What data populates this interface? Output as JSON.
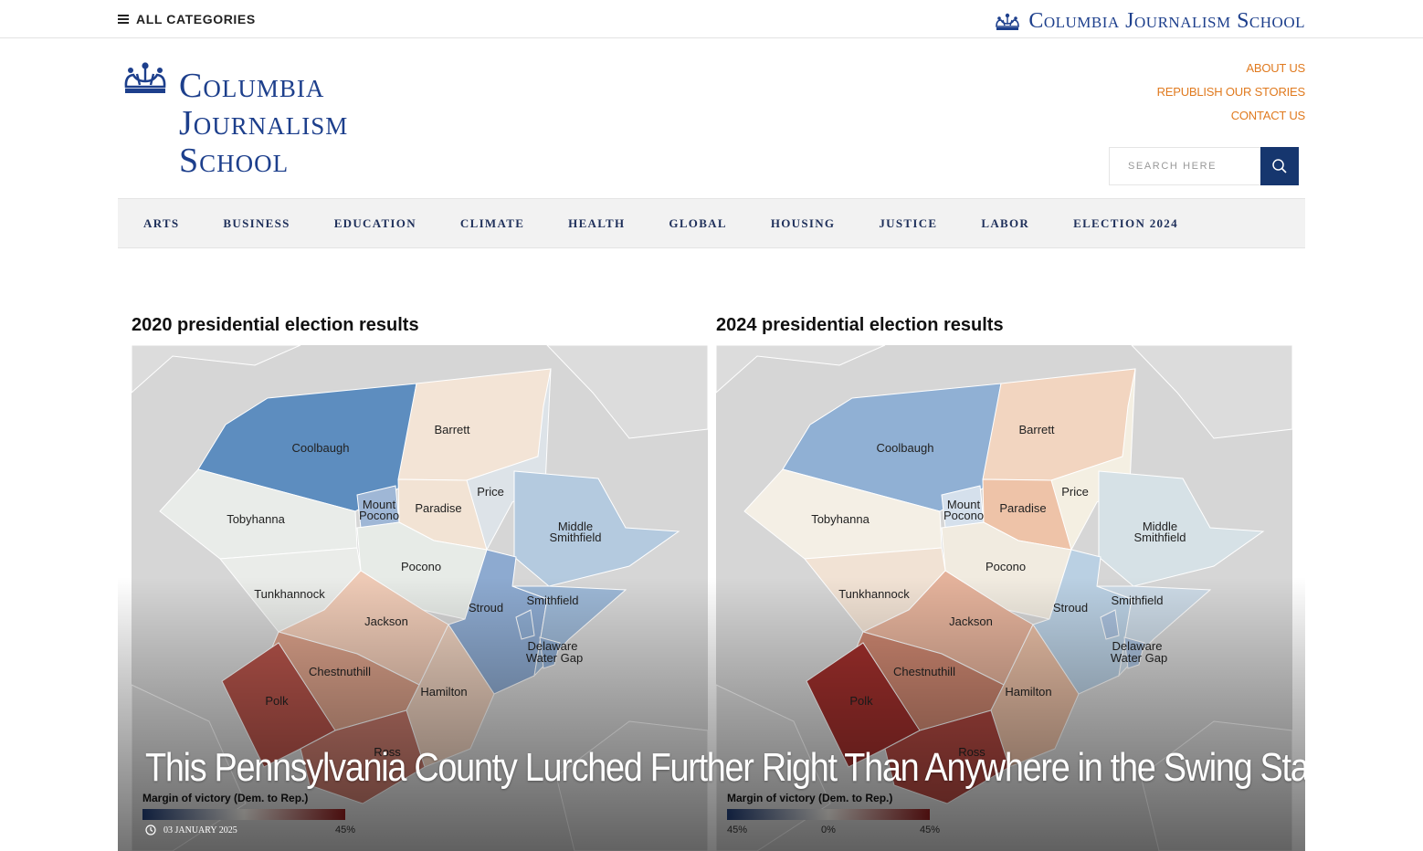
{
  "topbar": {
    "all_categories": "ALL CATEGORIES",
    "logo_text": "Columbia Journalism School"
  },
  "header": {
    "logo_lines": [
      "Columbia",
      "Journalism",
      "School"
    ],
    "links": [
      "ABOUT US",
      "REPUBLISH OUR STORIES",
      "CONTACT US"
    ],
    "search_placeholder": "SEARCH HERE"
  },
  "nav": [
    "ARTS",
    "BUSINESS",
    "EDUCATION",
    "CLIMATE",
    "HEALTH",
    "GLOBAL",
    "HOUSING",
    "JUSTICE",
    "LABOR",
    "ELECTION 2024"
  ],
  "hero": {
    "map_left_title": "2020 presidential election results",
    "map_right_title": "2024 presidential election results",
    "headline": "This Pennsylvania County Lurched Further Right Than Anywhere in the Swing State",
    "date": "03 JANUARY 2025",
    "legend_title": "Margin of victory (Dem. to Rep.)",
    "legend_ticks": [
      "45%",
      "0%",
      "45%"
    ],
    "map_labels": {
      "coolbaugh": "Coolbaugh",
      "barrett": "Barrett",
      "tobyhanna": "Tobyhanna",
      "mount": "Mount",
      "pocono_small": "Pocono",
      "paradise": "Paradise",
      "price": "Price",
      "middle": "Middle",
      "smithfield_line": "Smithfield",
      "pocono": "Pocono",
      "tunkhannock": "Tunkhannock",
      "stroud": "Stroud",
      "smithfield": "Smithfield",
      "jackson": "Jackson",
      "delaware": "Delaware",
      "watergap": "Water Gap",
      "chestnuthill": "Chestnuthill",
      "hamilton": "Hamilton",
      "polk": "Polk",
      "ross": "Ross"
    },
    "colors": {
      "left": {
        "coolbaugh": "#5d8dbf",
        "barrett": "#f3e4d6",
        "tobyhanna": "#e9ece9",
        "price": "#dde3e8",
        "mtpocono": "#9fb7d6",
        "paradise": "#f2e3d4",
        "middle": "#b4cadf",
        "pocono": "#e7ebe7",
        "tunkhannock": "#eaece9",
        "stroud": "#8daad0",
        "smithfield": "#9db8d6",
        "jackson": "#eecab6",
        "chestnuthill": "#d9a089",
        "hamilton": "#ebcfbd",
        "polk": "#b4534a",
        "ross": "#c2776a",
        "delaware": "#8eacd1"
      },
      "right": {
        "coolbaugh": "#90b0d4",
        "barrett": "#f2d5c0",
        "tobyhanna": "#f4efe5",
        "price": "#f4efe2",
        "mtpocono": "#d5e0ec",
        "paradise": "#eec3a8",
        "middle": "#d6e1e6",
        "pocono": "#f1ebe0",
        "tunkhannock": "#f1e2d4",
        "stroud": "#bad0e3",
        "smithfield": "#ccdae6",
        "jackson": "#e4b29b",
        "chestnuthill": "#cc8670",
        "hamilton": "#e8bea5",
        "polk": "#a02f2c",
        "ross": "#ae4740",
        "delaware": "#a9c0dc"
      }
    }
  }
}
